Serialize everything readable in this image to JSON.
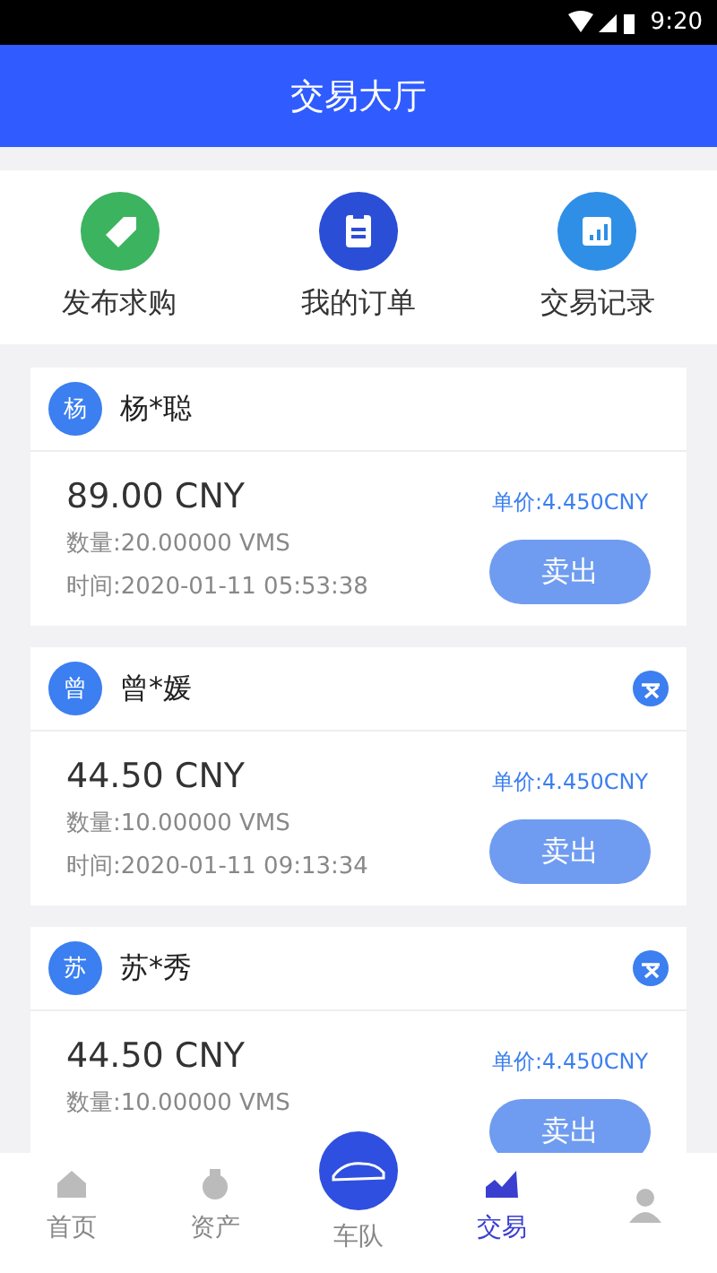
{
  "status_bar": {
    "time": "9:20"
  },
  "header": {
    "title": "交易大厅"
  },
  "quick_actions": [
    {
      "kind": "tag",
      "label": "发布求购",
      "color": "#3cb35f"
    },
    {
      "kind": "clipboard",
      "label": "我的订单",
      "color": "#2a4fd6"
    },
    {
      "kind": "calendar",
      "label": "交易记录",
      "color": "#2f8fe6"
    }
  ],
  "orders": [
    {
      "avatar": "杨",
      "name": "杨*聪",
      "badge": false,
      "amount": "89.00 CNY",
      "quantity": "数量:20.00000 VMS",
      "time": "时间:2020-01-11 05:53:38",
      "price": "单价:4.450CNY",
      "action": "卖出"
    },
    {
      "avatar": "曾",
      "name": "曾*媛",
      "badge": true,
      "amount": "44.50 CNY",
      "quantity": "数量:10.00000 VMS",
      "time": "时间:2020-01-11 09:13:34",
      "price": "单价:4.450CNY",
      "action": "卖出"
    },
    {
      "avatar": "苏",
      "name": "苏*秀",
      "badge": true,
      "amount": "44.50 CNY",
      "quantity": "数量:10.00000 VMS",
      "price": "单价:4.450CNY",
      "action": "卖出"
    }
  ],
  "tab_bar": [
    {
      "kind": "home",
      "label": "首页",
      "selected": false
    },
    {
      "kind": "assets",
      "label": "资产",
      "selected": false
    },
    {
      "kind": "fleet",
      "label": "车队",
      "selected": false
    },
    {
      "kind": "trade",
      "label": "交易",
      "selected": true
    },
    {
      "kind": "profile",
      "selected": false
    }
  ]
}
